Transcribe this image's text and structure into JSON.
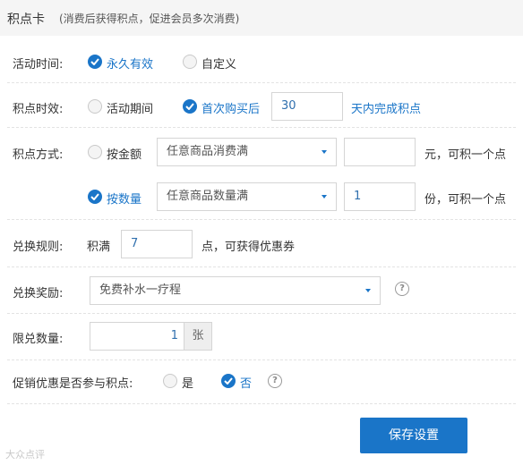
{
  "header": {
    "title": "积点卡",
    "subtitle": "(消费后获得积点，促进会员多次消费)"
  },
  "activity_time": {
    "label": "活动时间:",
    "options": [
      "永久有效",
      "自定义"
    ],
    "selected": "永久有效"
  },
  "validity": {
    "label": "积点时效:",
    "option_period": "活动期间",
    "option_first": "首次购买后",
    "days_value": "30",
    "days_suffix": "天内完成积点",
    "selected": "首次购买后"
  },
  "method": {
    "label": "积点方式:",
    "amount_option": "按金额",
    "amount_select": "任意商品消费满",
    "amount_value": "",
    "amount_suffix": "元，可积一个点",
    "quantity_option": "按数量",
    "quantity_select": "任意商品数量满",
    "quantity_value": "1",
    "quantity_suffix": "份，可积一个点",
    "selected": "按数量"
  },
  "rule": {
    "label": "兑换规则:",
    "prefix": "积满",
    "value": "7",
    "suffix": "点，可获得优惠券"
  },
  "reward": {
    "label": "兑换奖励:",
    "selected": "免费补水一疗程",
    "help_icon": "?"
  },
  "limit": {
    "label": "限兑数量:",
    "value": "1",
    "unit": "张"
  },
  "promo": {
    "label": "促销优惠是否参与积点:",
    "yes": "是",
    "no": "否",
    "selected": "否",
    "help_icon": "?"
  },
  "save_label": "保存设置",
  "watermark": "大众点评",
  "colors": {
    "accent": "#1a75c8",
    "header_bg": "#f5f5f5"
  }
}
